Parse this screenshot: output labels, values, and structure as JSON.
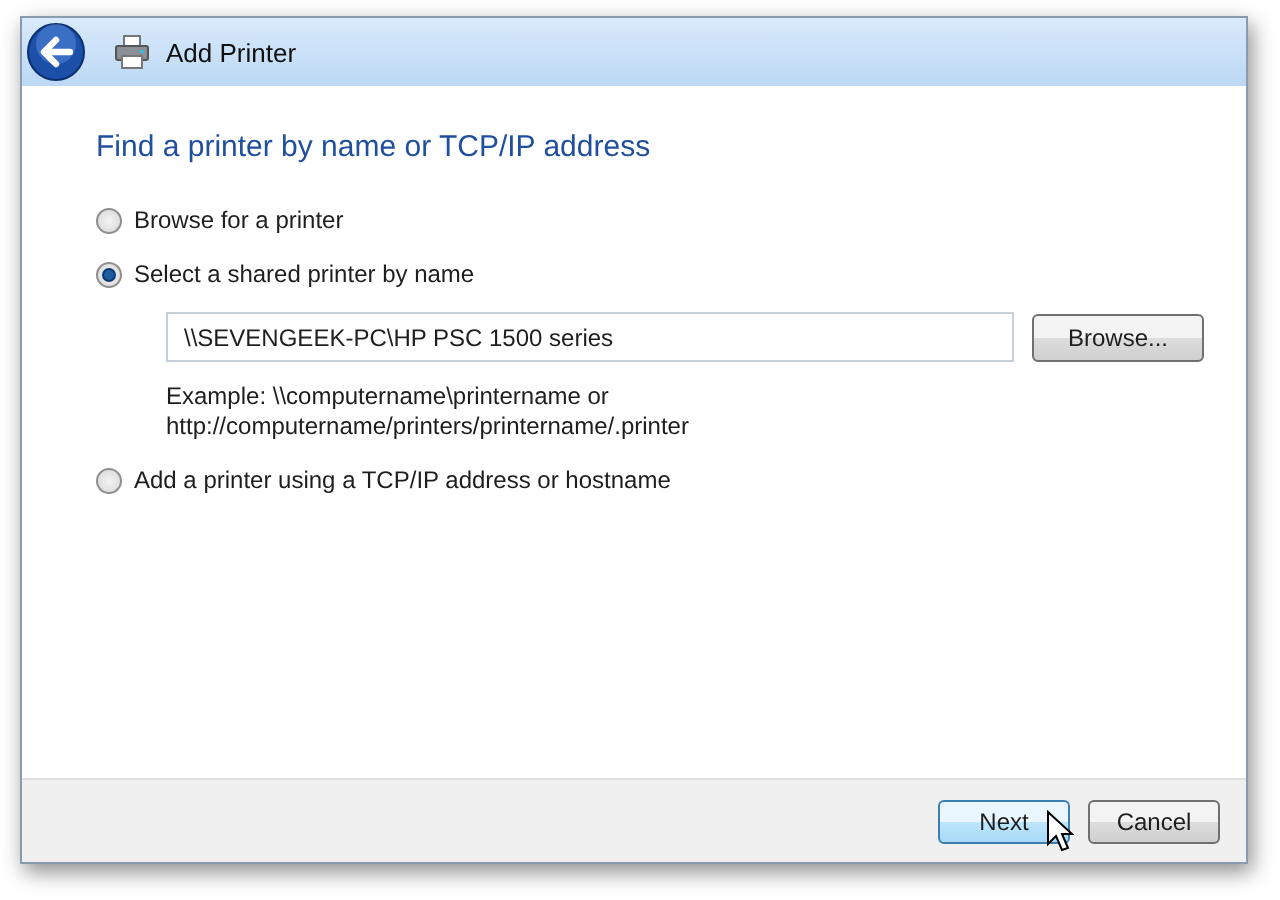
{
  "window": {
    "title": "Add Printer"
  },
  "heading": "Find a printer by name or TCP/IP address",
  "options": [
    {
      "label": "Browse for a printer",
      "selected": false
    },
    {
      "label": "Select a shared printer by name",
      "selected": true
    },
    {
      "label": "Add a printer using a TCP/IP address or hostname",
      "selected": false
    }
  ],
  "shared_printer": {
    "value": "\\\\SEVENGEEK-PC\\HP PSC 1500 series",
    "browse_button": "Browse...",
    "example": [
      "Example: \\\\computername\\printername or",
      "http://computername/printers/printername/.printer"
    ]
  },
  "buttons": [
    {
      "label": "Next",
      "highlighted": true
    },
    {
      "label": "Cancel",
      "highlighted": false
    }
  ]
}
